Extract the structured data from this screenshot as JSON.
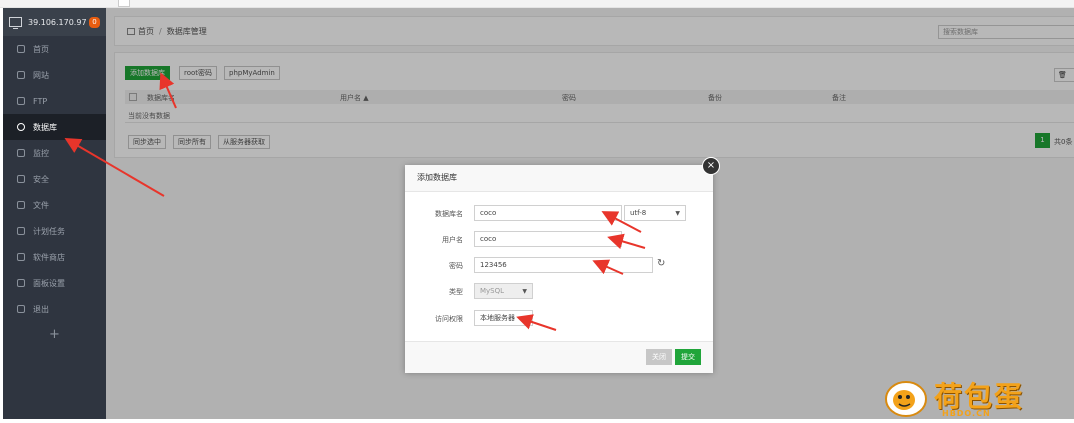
{
  "server": {
    "ip": "39.106.170.97",
    "badge": "0"
  },
  "sidebar": {
    "items": [
      {
        "label": "首页",
        "icon": "home-icon"
      },
      {
        "label": "网站",
        "icon": "globe-icon"
      },
      {
        "label": "FTP",
        "icon": "ftp-icon"
      },
      {
        "label": "数据库",
        "icon": "database-icon",
        "active": true
      },
      {
        "label": "监控",
        "icon": "monitor-icon"
      },
      {
        "label": "安全",
        "icon": "shield-icon"
      },
      {
        "label": "文件",
        "icon": "folder-icon"
      },
      {
        "label": "计划任务",
        "icon": "calendar-icon"
      },
      {
        "label": "软件商店",
        "icon": "grid-icon"
      },
      {
        "label": "面板设置",
        "icon": "gear-icon"
      },
      {
        "label": "退出",
        "icon": "logout-icon"
      }
    ],
    "add_label": "+"
  },
  "breadcrumb": {
    "home": "首页",
    "sep": "/",
    "current": "数据库管理"
  },
  "search": {
    "placeholder": "搜索数据库"
  },
  "toolbar": {
    "add_db": "添加数据库",
    "root_pwd": "root密码",
    "phpmyadmin": "phpMyAdmin"
  },
  "table": {
    "headers": {
      "name": "数据库名",
      "user": "用户名 ▲",
      "password": "密码",
      "backup": "备份",
      "note": "备注"
    },
    "empty": "当前没有数据"
  },
  "bottom_buttons": {
    "sync_selected": "同步选中",
    "sync_all": "同步所有",
    "fetch_server": "从服务器获取"
  },
  "pagination": {
    "page": "1",
    "total_text": "共0条"
  },
  "modal": {
    "title": "添加数据库",
    "close": "×",
    "fields": {
      "dbname_label": "数据库名",
      "dbname_value": "coco",
      "charset": "utf-8",
      "user_label": "用户名",
      "user_value": "coco",
      "pwd_label": "密码",
      "pwd_value": "123456",
      "type_label": "类型",
      "type_value": "MySQL",
      "access_label": "访问权限",
      "access_value": "本地服务器"
    },
    "buttons": {
      "close": "关闭",
      "submit": "提交"
    }
  },
  "colors": {
    "accent": "#20a53a",
    "sidebar": "#2f3540",
    "arrow": "#e8352b",
    "badge": "#e85d10"
  },
  "watermark": {
    "brand": "荷包蛋",
    "domain": "HBDO.CN"
  }
}
